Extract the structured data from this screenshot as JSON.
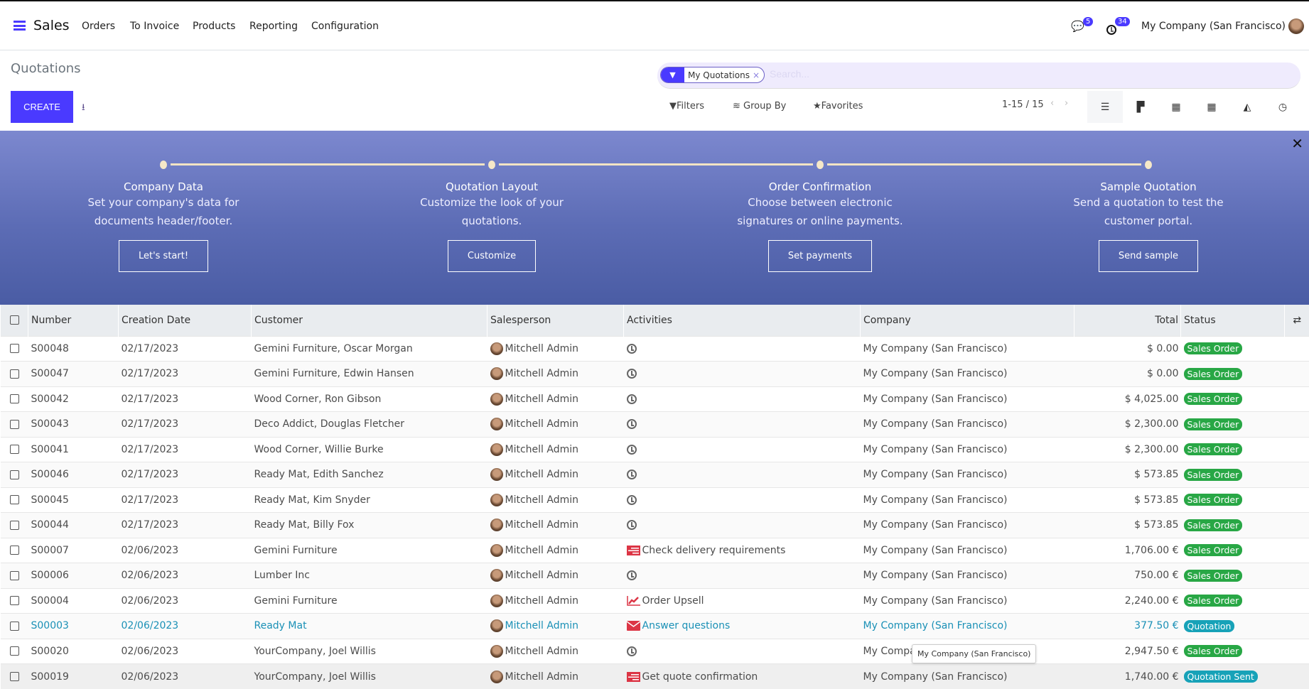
{
  "nav": {
    "app": "Sales",
    "items": [
      "Orders",
      "To Invoice",
      "Products",
      "Reporting",
      "Configuration"
    ],
    "messages_count": "5",
    "activities_count": "34",
    "company": "My Company (San Francisco)"
  },
  "page": {
    "title": "Quotations",
    "create": "CREATE"
  },
  "search": {
    "facet": "My Quotations",
    "placeholder": "Search..."
  },
  "toolbar": {
    "filters": "Filters",
    "group_by": "Group By",
    "favorites": "Favorites",
    "pager": "1-15 / 15"
  },
  "banner": {
    "steps": [
      {
        "title": "Company Data",
        "line1": "Set your company's data for",
        "line2": "documents header/footer.",
        "button": "Let's start!"
      },
      {
        "title": "Quotation Layout",
        "line1": "Customize the look of your",
        "line2": "quotations.",
        "button": "Customize"
      },
      {
        "title": "Order Confirmation",
        "line1": "Choose between electronic",
        "line2": "signatures or online payments.",
        "button": "Set payments"
      },
      {
        "title": "Sample Quotation",
        "line1": "Send a quotation to test the",
        "line2": "customer portal.",
        "button": "Send sample"
      }
    ]
  },
  "table": {
    "headers": [
      "Number",
      "Creation Date",
      "Customer",
      "Salesperson",
      "Activities",
      "Company",
      "Total",
      "Status"
    ],
    "rows": [
      [
        "S00048",
        "02/17/2023",
        "Gemini Furniture, Oscar Morgan",
        "Mitchell Admin",
        "",
        "clock",
        "My Company (San Francisco)",
        "$ 0.00",
        "Sales Order"
      ],
      [
        "S00047",
        "02/17/2023",
        "Gemini Furniture, Edwin Hansen",
        "Mitchell Admin",
        "",
        "clock",
        "My Company (San Francisco)",
        "$ 0.00",
        "Sales Order"
      ],
      [
        "S00042",
        "02/17/2023",
        "Wood Corner, Ron Gibson",
        "Mitchell Admin",
        "",
        "clock",
        "My Company (San Francisco)",
        "$ 4,025.00",
        "Sales Order"
      ],
      [
        "S00043",
        "02/17/2023",
        "Deco Addict, Douglas Fletcher",
        "Mitchell Admin",
        "",
        "clock",
        "My Company (San Francisco)",
        "$ 2,300.00",
        "Sales Order"
      ],
      [
        "S00041",
        "02/17/2023",
        "Wood Corner, Willie Burke",
        "Mitchell Admin",
        "",
        "clock",
        "My Company (San Francisco)",
        "$ 2,300.00",
        "Sales Order"
      ],
      [
        "S00046",
        "02/17/2023",
        "Ready Mat, Edith Sanchez",
        "Mitchell Admin",
        "",
        "clock",
        "My Company (San Francisco)",
        "$ 573.85",
        "Sales Order"
      ],
      [
        "S00045",
        "02/17/2023",
        "Ready Mat, Kim Snyder",
        "Mitchell Admin",
        "",
        "clock",
        "My Company (San Francisco)",
        "$ 573.85",
        "Sales Order"
      ],
      [
        "S00044",
        "02/17/2023",
        "Ready Mat, Billy Fox",
        "Mitchell Admin",
        "",
        "clock",
        "My Company (San Francisco)",
        "$ 573.85",
        "Sales Order"
      ],
      [
        "S00007",
        "02/06/2023",
        "Gemini Furniture",
        "Mitchell Admin",
        "Check delivery requirements",
        "tasks",
        "My Company (San Francisco)",
        "1,706.00 €",
        "Sales Order"
      ],
      [
        "S00006",
        "02/06/2023",
        "Lumber Inc",
        "Mitchell Admin",
        "",
        "clock",
        "My Company (San Francisco)",
        "750.00 €",
        "Sales Order"
      ],
      [
        "S00004",
        "02/06/2023",
        "Gemini Furniture",
        "Mitchell Admin",
        "Order Upsell",
        "chart",
        "My Company (San Francisco)",
        "2,240.00 €",
        "Sales Order"
      ],
      [
        "S00003",
        "02/06/2023",
        "Ready Mat",
        "Mitchell Admin",
        "Answer questions",
        "envelope",
        "My Company (San Francisco)",
        "377.50 €",
        "Quotation"
      ],
      [
        "S00020",
        "02/06/2023",
        "YourCompany, Joel Willis",
        "Mitchell Admin",
        "",
        "clock",
        "My Company (San Francisco)",
        "2,947.50 €",
        "Sales Order"
      ],
      [
        "S00019",
        "02/06/2023",
        "YourCompany, Joel Willis",
        "Mitchell Admin",
        "Get quote confirmation",
        "tasks",
        "My Company (San Francisco)",
        "1,740.00 €",
        "Quotation Sent"
      ]
    ]
  },
  "tooltip": "My Company (San Francisco)",
  "colors": {
    "accent": "#4a3aff",
    "sales_order": "#28a745",
    "quotation": "#17a2b8",
    "danger": "#dc3545"
  }
}
